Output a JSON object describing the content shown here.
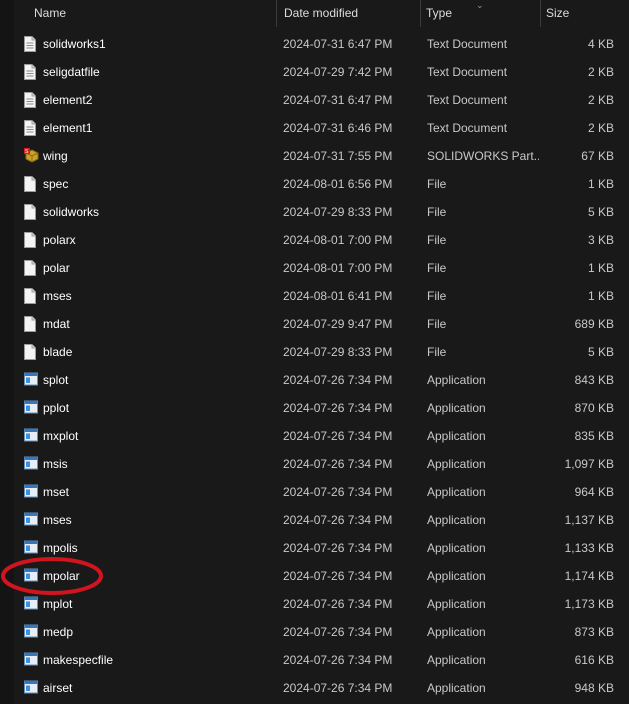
{
  "header": {
    "name": "Name",
    "date_modified": "Date modified",
    "type": "Type",
    "size": "Size"
  },
  "files": [
    {
      "name": "solidworks1",
      "date": "2024-07-31 6:47 PM",
      "type": "Text Document",
      "size": "4 KB",
      "icon": "text-document-icon"
    },
    {
      "name": "seligdatfile",
      "date": "2024-07-29 7:42 PM",
      "type": "Text Document",
      "size": "2 KB",
      "icon": "text-document-icon"
    },
    {
      "name": "element2",
      "date": "2024-07-31 6:47 PM",
      "type": "Text Document",
      "size": "2 KB",
      "icon": "text-document-icon"
    },
    {
      "name": "element1",
      "date": "2024-07-31 6:46 PM",
      "type": "Text Document",
      "size": "2 KB",
      "icon": "text-document-icon"
    },
    {
      "name": "wing",
      "date": "2024-07-31 7:55 PM",
      "type": "SOLIDWORKS Part...",
      "size": "67 KB",
      "icon": "solidworks-part-icon"
    },
    {
      "name": "spec",
      "date": "2024-08-01 6:56 PM",
      "type": "File",
      "size": "1 KB",
      "icon": "file-icon"
    },
    {
      "name": "solidworks",
      "date": "2024-07-29 8:33 PM",
      "type": "File",
      "size": "5 KB",
      "icon": "file-icon"
    },
    {
      "name": "polarx",
      "date": "2024-08-01 7:00 PM",
      "type": "File",
      "size": "3 KB",
      "icon": "file-icon"
    },
    {
      "name": "polar",
      "date": "2024-08-01 7:00 PM",
      "type": "File",
      "size": "1 KB",
      "icon": "file-icon"
    },
    {
      "name": "mses",
      "date": "2024-08-01 6:41 PM",
      "type": "File",
      "size": "1 KB",
      "icon": "file-icon"
    },
    {
      "name": "mdat",
      "date": "2024-07-29 9:47 PM",
      "type": "File",
      "size": "689 KB",
      "icon": "file-icon"
    },
    {
      "name": "blade",
      "date": "2024-07-29 8:33 PM",
      "type": "File",
      "size": "5 KB",
      "icon": "file-icon"
    },
    {
      "name": "splot",
      "date": "2024-07-26 7:34 PM",
      "type": "Application",
      "size": "843 KB",
      "icon": "application-icon"
    },
    {
      "name": "pplot",
      "date": "2024-07-26 7:34 PM",
      "type": "Application",
      "size": "870 KB",
      "icon": "application-icon"
    },
    {
      "name": "mxplot",
      "date": "2024-07-26 7:34 PM",
      "type": "Application",
      "size": "835 KB",
      "icon": "application-icon"
    },
    {
      "name": "msis",
      "date": "2024-07-26 7:34 PM",
      "type": "Application",
      "size": "1,097 KB",
      "icon": "application-icon"
    },
    {
      "name": "mset",
      "date": "2024-07-26 7:34 PM",
      "type": "Application",
      "size": "964 KB",
      "icon": "application-icon"
    },
    {
      "name": "mses",
      "date": "2024-07-26 7:34 PM",
      "type": "Application",
      "size": "1,137 KB",
      "icon": "application-icon"
    },
    {
      "name": "mpolis",
      "date": "2024-07-26 7:34 PM",
      "type": "Application",
      "size": "1,133 KB",
      "icon": "application-icon"
    },
    {
      "name": "mpolar",
      "date": "2024-07-26 7:34 PM",
      "type": "Application",
      "size": "1,174 KB",
      "icon": "application-icon",
      "highlighted": true
    },
    {
      "name": "mplot",
      "date": "2024-07-26 7:34 PM",
      "type": "Application",
      "size": "1,173 KB",
      "icon": "application-icon"
    },
    {
      "name": "medp",
      "date": "2024-07-26 7:34 PM",
      "type": "Application",
      "size": "873 KB",
      "icon": "application-icon"
    },
    {
      "name": "makespecfile",
      "date": "2024-07-26 7:34 PM",
      "type": "Application",
      "size": "616 KB",
      "icon": "application-icon"
    },
    {
      "name": "airset",
      "date": "2024-07-26 7:34 PM",
      "type": "Application",
      "size": "948 KB",
      "icon": "application-icon"
    }
  ],
  "colors": {
    "background": "#191919",
    "text": "#ffffff",
    "secondary_text": "#c8c8c8",
    "highlight_circle": "#d2141e"
  }
}
